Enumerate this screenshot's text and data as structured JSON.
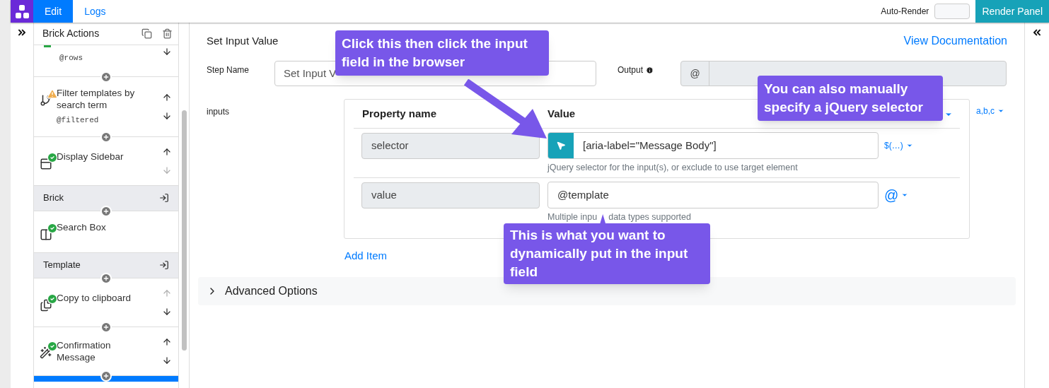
{
  "app": {
    "tabs": [
      {
        "label": "Edit",
        "selected": true
      },
      {
        "label": "Logs",
        "selected": false
      }
    ],
    "auto_render": {
      "label": "Auto-Render",
      "on": false
    },
    "render_button": "Render Panel"
  },
  "sidebar": {
    "title": "Brick Actions",
    "items": [
      {
        "kind": "brick_partial",
        "output": "@rows",
        "warning": false,
        "down_disabled": false
      },
      {
        "kind": "brick",
        "title": "Filter templates by search term",
        "output": "@filtered",
        "warning": true,
        "movable": true,
        "up_disabled": false,
        "down_disabled": false,
        "selected": false
      },
      {
        "kind": "brick",
        "title": "Display Sidebar",
        "warning": false,
        "movable": true,
        "up_disabled": false,
        "down_disabled": true,
        "selected": false
      },
      {
        "kind": "group",
        "title": "Brick"
      },
      {
        "kind": "brick",
        "title": "Search Box",
        "warning": false,
        "movable": false,
        "selected": false
      },
      {
        "kind": "group",
        "title": "Template"
      },
      {
        "kind": "brick",
        "title": "Copy to clipboard",
        "warning": false,
        "movable": true,
        "up_disabled": true,
        "down_disabled": false,
        "selected": false
      },
      {
        "kind": "brick",
        "title": "Confirmation Message",
        "warning": false,
        "movable": true,
        "up_disabled": false,
        "down_disabled": false,
        "selected": false
      },
      {
        "kind": "brick_cut",
        "selected": true
      }
    ]
  },
  "editor": {
    "title": "Set Input Value",
    "docs_link": "View Documentation",
    "step_name": {
      "label": "Step Name",
      "value": "Set Input V"
    },
    "output": {
      "label": "Output",
      "prefix": "@"
    },
    "inputs": {
      "label": "inputs",
      "columns": [
        "Property name",
        "Value"
      ],
      "type_toggle": "a,b,c",
      "rows": [
        {
          "kind": "selector",
          "name": "selector",
          "value": "[aria-label=\"Message Body\"]",
          "help": "jQuery selector for the input(s), or exclude to use target element",
          "toggle": "$(…)"
        },
        {
          "kind": "textarea",
          "name": "value",
          "value": "@template",
          "help": "Multiple inpu",
          "help_after": "data types supported",
          "toggle": "@"
        }
      ],
      "add_item": "Add Item"
    },
    "advanced": {
      "label": "Advanced Options",
      "expanded": false
    }
  },
  "callouts": [
    {
      "text": "Click this then click the input field in the browser"
    },
    {
      "text": "You can also manually specify a jQuery selector"
    },
    {
      "text": "This is what you want to dynamically put in the input field"
    }
  ]
}
